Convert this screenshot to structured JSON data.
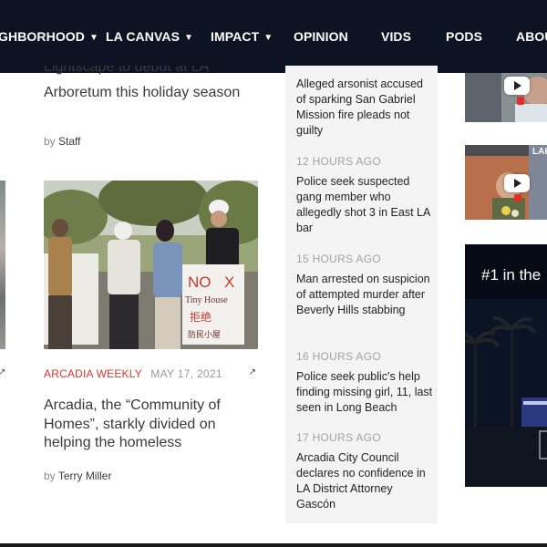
{
  "nav": {
    "items": [
      {
        "label": "GHBORHOOD",
        "chevron": true
      },
      {
        "label": "LA CANVAS",
        "chevron": true
      },
      {
        "label": "IMPACT",
        "chevron": true
      },
      {
        "label": "OPINION",
        "chevron": false
      },
      {
        "label": "VIDS",
        "chevron": false
      },
      {
        "label": "PODS",
        "chevron": false
      },
      {
        "label": "ABOU",
        "chevron": false
      }
    ]
  },
  "articles": {
    "top": {
      "title_line1_clipped": "Lightscape to debut at LA",
      "title_line2": "Arboretum this holiday season",
      "by_prefix": "by",
      "author": "Staff"
    },
    "main": {
      "category": "ARCADIA WEEKLY",
      "date": "MAY 17, 2021",
      "title": "Arcadia, the “Community of Homes”, starkly divided on helping the homeless",
      "by_prefix": "by",
      "author": "Terry Miller",
      "sign_text": [
        "NO",
        "Tiny House",
        "拒绝",
        "防民小屋"
      ]
    }
  },
  "news_list": [
    {
      "time": "",
      "title": "Alleged arsonist accused of sparking San Gabriel Mission fire pleads not guilty"
    },
    {
      "time": "12 HOURS AGO",
      "title": "Police seek suspected gang member who allegedly shot 3 in East LA bar"
    },
    {
      "time": "15 HOURS AGO",
      "title": "Man arrested on suspicion of attempted murder after Beverly Hills stabbing"
    },
    {
      "time": "16 HOURS AGO",
      "title": "Police seek public's help finding missing girl, 11, last seen in Long Beach"
    },
    {
      "time": "17 HOURS AGO",
      "title": "Arcadia City Council declares no confidence in LA District Attorney Gascón"
    }
  ],
  "videos": {
    "thumb2_caption": "LAKE"
  },
  "ad": {
    "text": "#1 in the"
  },
  "colors": {
    "nav_bg": "#0d1322",
    "category_red": "#d33a2c",
    "panel_bg": "#f4f4f4",
    "youtube_red": "#e52d27"
  },
  "icons": {
    "share": "arrow-up-right-icon",
    "chevron": "chevron-down-icon",
    "play": "play-icon"
  }
}
